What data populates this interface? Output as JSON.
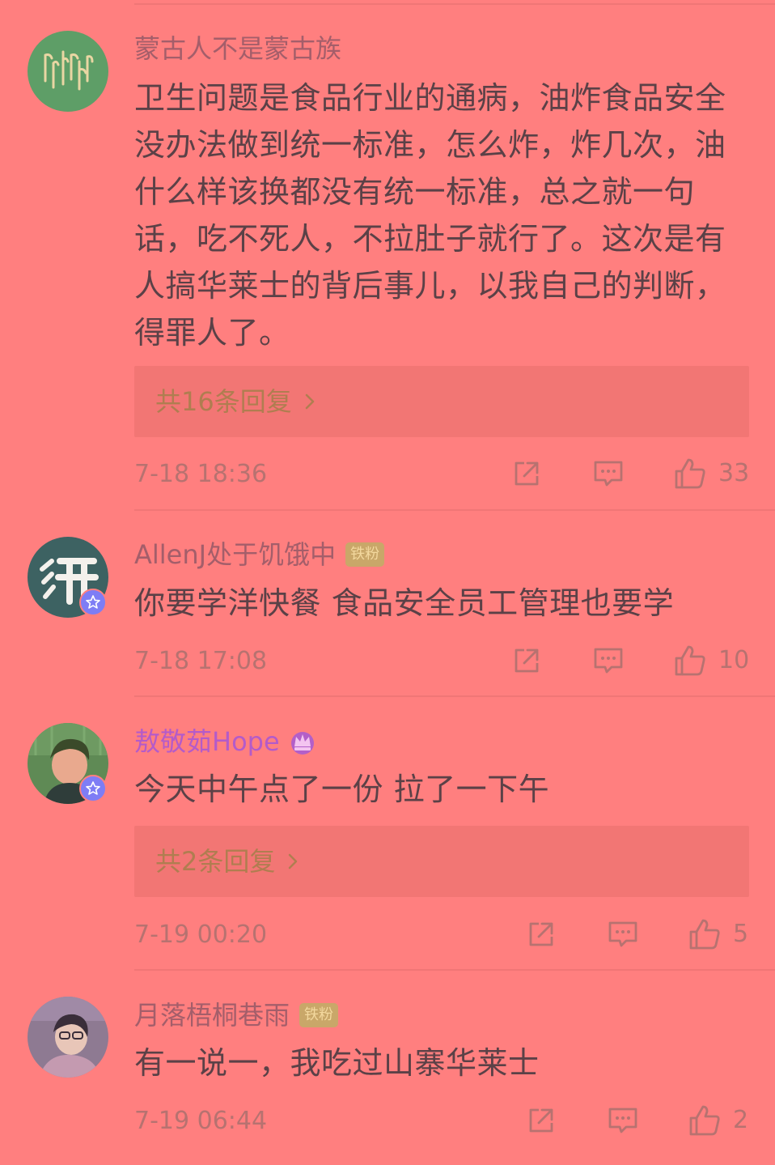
{
  "comments": [
    {
      "username": "蒙古人不是蒙古族",
      "avatar": "mongolian-script-avatar",
      "content": "卫生问题是食品行业的通病，油炸食品安全没办法做到统一标准，怎么炸，炸几次，油什么样该换都没有统一标准，总之就一句话，吃不死人，不拉肚子就行了。这次是有人搞华莱士的背后事儿，以我自己的判断，得罪人了。",
      "content_lines": [
        "卫生问题是食品行业的通病，油炸食品安全",
        "没办法做到统一标准，怎么炸，炸几次，油",
        "什么样该换都没有统一标准，总之就一句",
        "话，吃不死人，不拉肚子就行了。这次是有",
        "人搞华莱士的背后事儿，以我自己的判断，",
        "得罪人了。"
      ],
      "replies_label": "共16条回复",
      "time": "7-18 18:36",
      "likes": "33"
    },
    {
      "username": "AllenJ处于饥饿中",
      "badge": "铁粉",
      "avatar": "ping-logo-avatar",
      "content": "你要学洋快餐 食品安全员工管理也要学",
      "time": "7-18 17:08",
      "likes": "10"
    },
    {
      "username": "敖敬茹Hope",
      "badge_icon": "crown-badge",
      "avatar": "girl-photo-avatar",
      "content": "今天中午点了一份 拉了一下午",
      "replies_label": "共2条回复",
      "time": "7-19 00:20",
      "likes": "5"
    },
    {
      "username": "月落梧桐巷雨",
      "badge": "铁粉",
      "avatar": "person-photo-avatar",
      "content": "有一说一，我吃过山寨华莱士",
      "time": "7-19 06:44",
      "likes": "2"
    }
  ],
  "icons": {
    "share": "share-icon",
    "comment": "comment-icon",
    "like": "thumbs-up-icon",
    "reply_chevron": "chevron-right-icon",
    "verified": "star-verified-icon"
  },
  "colors": {
    "background": "#FF7F7F",
    "username": "#A45E6A",
    "vip_username": "#B45BC9",
    "content": "#5B4147",
    "meta": "#B77270",
    "reply_link": "#B07D50",
    "reply_box": "#F27674"
  }
}
